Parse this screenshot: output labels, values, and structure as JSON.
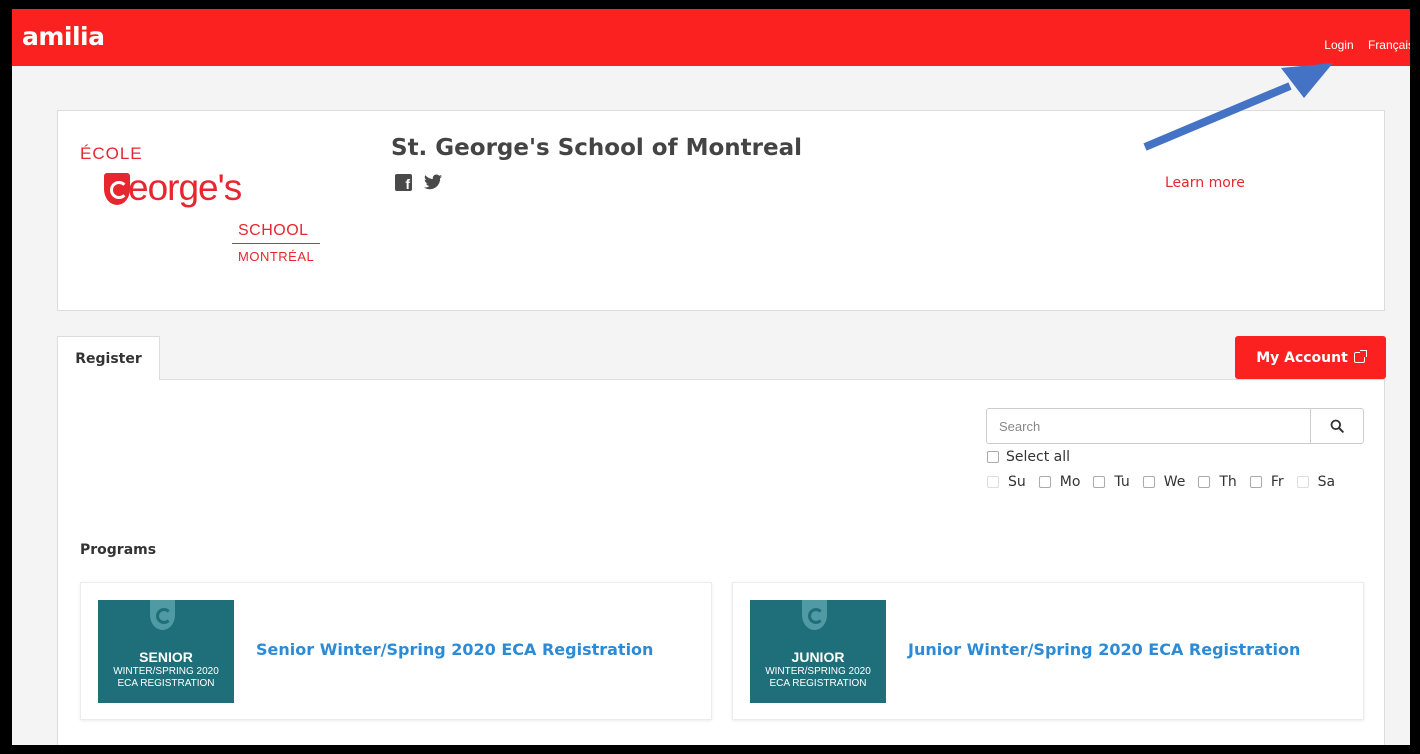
{
  "header": {
    "logo": "amilia",
    "login_label": "Login",
    "language_label": "Français"
  },
  "organization": {
    "logo": {
      "ecole": "ÉCOLE",
      "george": "eorge's",
      "school": "SCHOOL",
      "montreal": "MONTRÉAL"
    },
    "name": "St. George's School of Montreal",
    "social": [
      "facebook-icon",
      "twitter-icon"
    ],
    "learn_more": "Learn more"
  },
  "nav": {
    "register_tab": "Register",
    "my_account": "My Account"
  },
  "filters": {
    "search_placeholder": "Search",
    "select_all": "Select all",
    "days": [
      "Su",
      "Mo",
      "Tu",
      "We",
      "Th",
      "Fr",
      "Sa"
    ]
  },
  "programs": {
    "title": "Programs",
    "items": [
      {
        "thumb_level": "SENIOR",
        "thumb_line1": "WINTER/SPRING 2020",
        "thumb_line2": "ECA REGISTRATION",
        "title": "Senior Winter/Spring 2020 ECA Registration"
      },
      {
        "thumb_level": "JUNIOR",
        "thumb_line1": "WINTER/SPRING 2020",
        "thumb_line2": "ECA REGISTRATION",
        "title": "Junior Winter/Spring 2020 ECA Registration"
      }
    ]
  },
  "colors": {
    "brand_red": "#fc2121",
    "school_red": "#e8262f",
    "link_blue": "#2d8bd6",
    "thumb_teal": "#1f6f7a",
    "annotation_arrow": "#4472c4"
  }
}
